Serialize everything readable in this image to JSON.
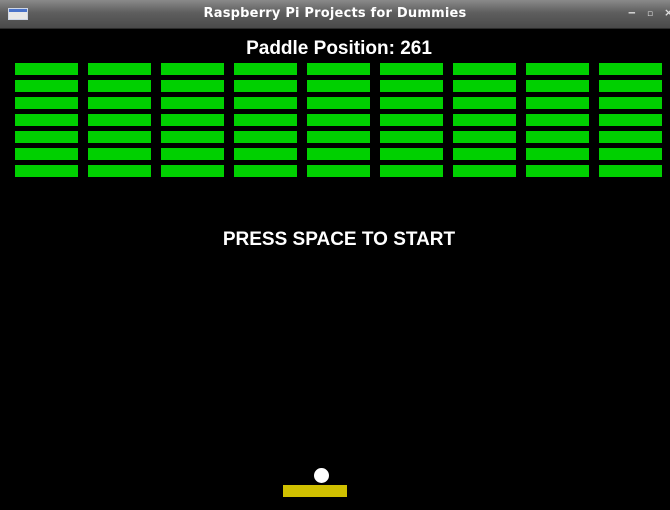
{
  "window": {
    "title": "Raspberry Pi Projects for Dummies",
    "controls": {
      "minimize": "‒",
      "maximize": "▫",
      "close": "×"
    }
  },
  "game": {
    "score_text": "Paddle Position: 261",
    "paddle_position": 261,
    "message": "PRESS SPACE TO START",
    "bricks": {
      "rows": 7,
      "columns": 9,
      "color": "#00d000"
    },
    "paddle_color": "#d0c000",
    "ball_color": "#ffffff",
    "background": "#000000"
  }
}
